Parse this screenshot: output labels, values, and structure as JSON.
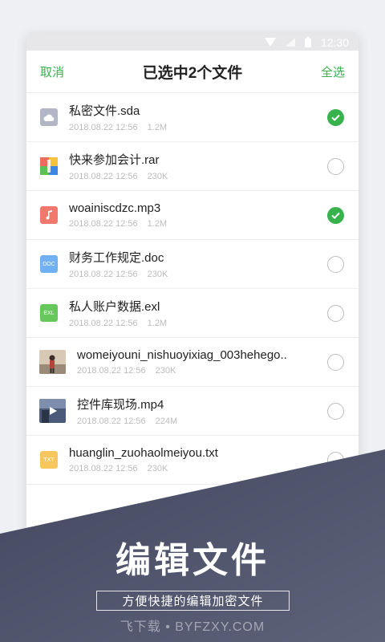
{
  "status_bar": {
    "time": "12:30"
  },
  "header": {
    "cancel": "取消",
    "title": "已选中2个文件",
    "select_all": "全选"
  },
  "files": [
    {
      "name": "私密文件.sda",
      "date": "2018.08.22 12:56",
      "size": "1.2M",
      "selected": true,
      "icon": "cloud-file-icon",
      "icon_color": "#b3b6c6"
    },
    {
      "name": "快来参加会计.rar",
      "date": "2018.08.22 12:56",
      "size": "230K",
      "selected": false,
      "icon": "archive-file-icon",
      "icon_color": "#3a87e4"
    },
    {
      "name": "woainiscdzc.mp3",
      "date": "2018.08.22 12:56",
      "size": "1.2M",
      "selected": true,
      "icon": "music-file-icon",
      "icon_color": "#f2776c"
    },
    {
      "name": "财务工作规定.doc",
      "date": "2018.08.22 12:56",
      "size": "230K",
      "selected": false,
      "icon": "doc-file-icon",
      "icon_color": "#6fb1f2",
      "icon_text": "DOC"
    },
    {
      "name": "私人账户数据.exl",
      "date": "2018.08.22 12:56",
      "size": "1.2M",
      "selected": false,
      "icon": "excel-file-icon",
      "icon_color": "#66c85a",
      "icon_text": "EXL"
    },
    {
      "name": "womeiyouni_nishuoyixiag_003hehego..",
      "date": "2018.08.22 12:56",
      "size": "230K",
      "selected": false,
      "icon": "image-thumbnail"
    },
    {
      "name": "控件库现场.mp4",
      "date": "2018.08.22 12:56",
      "size": "224M",
      "selected": false,
      "icon": "video-thumbnail"
    },
    {
      "name": "huanglin_zuohaolmeiyou.txt",
      "date": "2018.08.22 12:56",
      "size": "230K",
      "selected": false,
      "icon": "txt-file-icon",
      "icon_color": "#f7c65c",
      "icon_text": "TXT"
    }
  ],
  "banner": {
    "title": "编辑文件",
    "subtitle": "方便快捷的编辑加密文件",
    "brand": "飞下载 • BYFZXY.COM"
  },
  "colors": {
    "accent": "#37b24d",
    "overlay": "#4e5368"
  }
}
